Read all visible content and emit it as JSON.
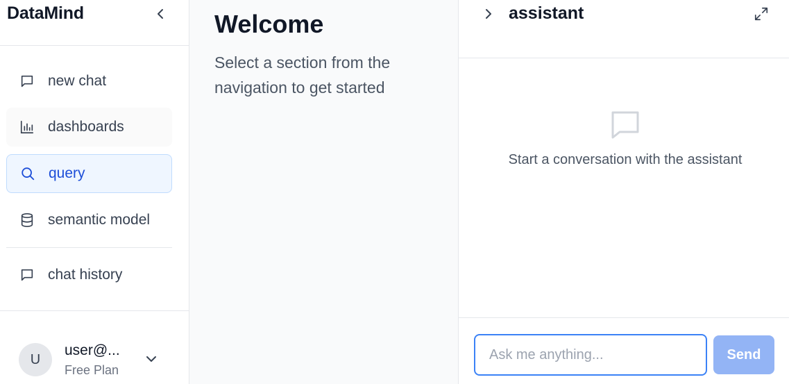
{
  "sidebar": {
    "brand": "DataMind",
    "items": [
      {
        "label": "new chat",
        "icon": "message-square-icon"
      },
      {
        "label": "dashboards",
        "icon": "bar-chart-icon"
      },
      {
        "label": "query",
        "icon": "search-icon",
        "active": true
      },
      {
        "label": "semantic model",
        "icon": "database-icon"
      },
      {
        "label": "chat history",
        "icon": "message-square-icon"
      }
    ],
    "user": {
      "avatar_initial": "U",
      "name": "user@...",
      "plan": "Free Plan"
    }
  },
  "main": {
    "title": "Welcome",
    "subtitle": "Select a section from the navigation to get started"
  },
  "assistant": {
    "title": "assistant",
    "empty_message": "Start a conversation with the assistant",
    "input_placeholder": "Ask me anything...",
    "input_value": "",
    "send_label": "Send"
  },
  "colors": {
    "accent": "#3b82f6",
    "active_bg": "#eff6ff",
    "active_text": "#1d4ed8",
    "send_disabled": "#93b4f5"
  }
}
